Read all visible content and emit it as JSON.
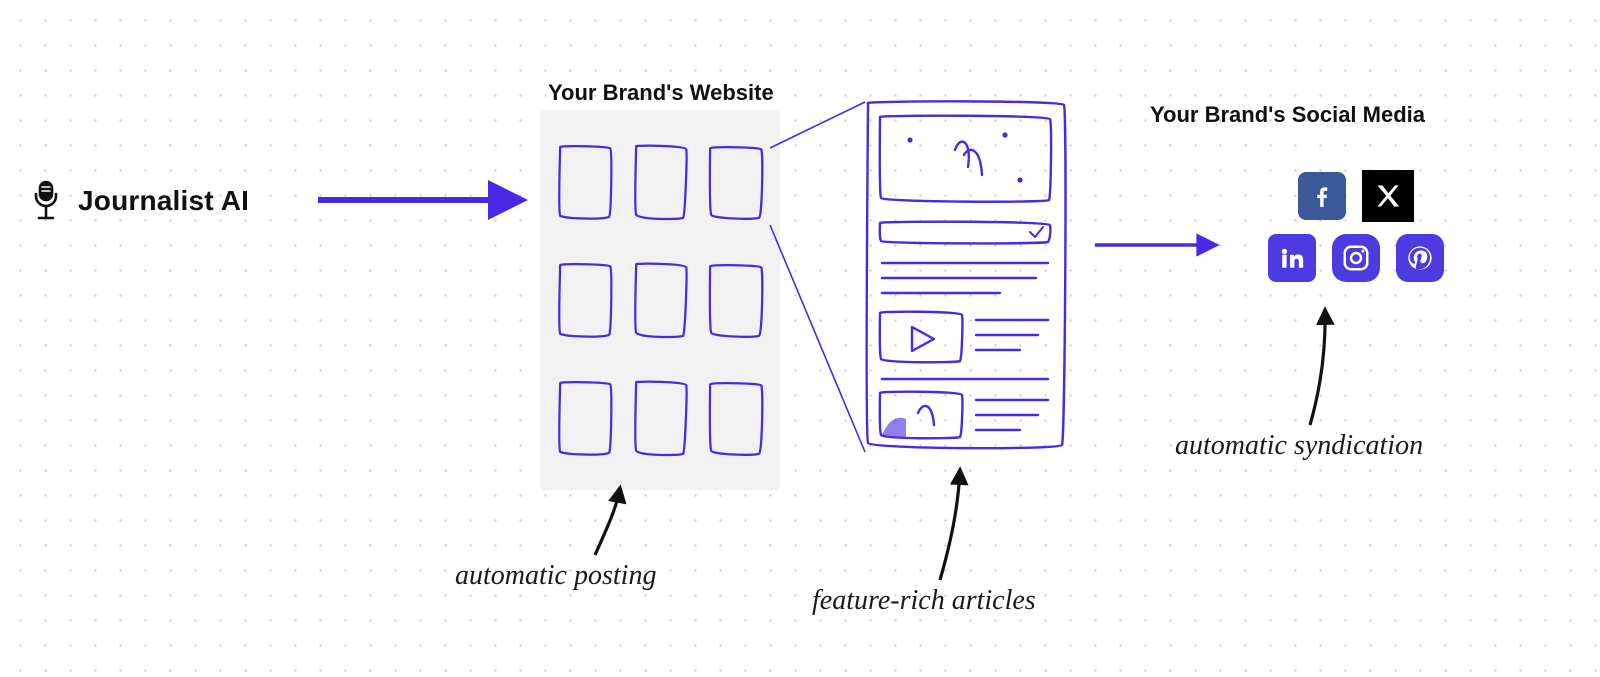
{
  "colors": {
    "ink": "#111111",
    "sketch": "#4b28e6",
    "panel": "#f1f1f1",
    "hand": "#1a1a1a",
    "fb": "#3b5998",
    "social_purple": "#4b3be0",
    "x_black": "#000000",
    "white": "#ffffff"
  },
  "nodes": {
    "journalist": {
      "label": "Journalist AI",
      "icon": "microphone-icon"
    },
    "website": {
      "label": "Your Brand's Website"
    },
    "article": {
      "label_implicit": "article detail"
    },
    "social": {
      "label": "Your Brand's Social Media",
      "icons": [
        "facebook",
        "x-twitter",
        "linkedin",
        "instagram",
        "pinterest"
      ]
    }
  },
  "captions": {
    "posting": "automatic posting",
    "articles": "feature-rich articles",
    "syndication": "automatic syndication"
  },
  "arrows": {
    "jai_to_site": "straight",
    "site_to_article": "zoom-expand",
    "article_to_social": "straight",
    "caption_to_site": "curved-up",
    "caption_to_article": "curved-up",
    "caption_to_social": "curved-up"
  }
}
